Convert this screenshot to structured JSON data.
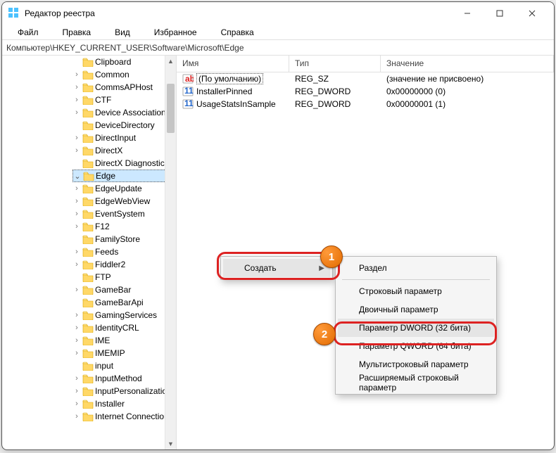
{
  "window": {
    "title": "Редактор реестра"
  },
  "menu": [
    "Файл",
    "Правка",
    "Вид",
    "Избранное",
    "Справка"
  ],
  "address": "Компьютер\\HKEY_CURRENT_USER\\Software\\Microsoft\\Edge",
  "list": {
    "headers": {
      "name": "Имя",
      "type": "Тип",
      "value": "Значение"
    },
    "rows": [
      {
        "icon": "string",
        "name": "(По умолчанию)",
        "type": "REG_SZ",
        "value": "(значение не присвоено)",
        "selected": true
      },
      {
        "icon": "dword",
        "name": "InstallerPinned",
        "type": "REG_DWORD",
        "value": "0x00000000 (0)"
      },
      {
        "icon": "dword",
        "name": "UsageStatsInSample",
        "type": "REG_DWORD",
        "value": "0x00000001 (1)"
      }
    ]
  },
  "tree": [
    {
      "name": "Clipboard",
      "caret": false
    },
    {
      "name": "Common",
      "caret": true
    },
    {
      "name": "CommsAPHost",
      "caret": true
    },
    {
      "name": "CTF",
      "caret": true
    },
    {
      "name": "Device Association",
      "caret": true,
      "truncated": true
    },
    {
      "name": "DeviceDirectory",
      "caret": false
    },
    {
      "name": "DirectInput",
      "caret": true
    },
    {
      "name": "DirectX",
      "caret": true
    },
    {
      "name": "DirectX Diagnostic",
      "caret": false,
      "truncated": true
    },
    {
      "name": "Edge",
      "caret": true,
      "open": true,
      "selected": true
    },
    {
      "name": "EdgeUpdate",
      "caret": true
    },
    {
      "name": "EdgeWebView",
      "caret": true
    },
    {
      "name": "EventSystem",
      "caret": true
    },
    {
      "name": "F12",
      "caret": true
    },
    {
      "name": "FamilyStore",
      "caret": false
    },
    {
      "name": "Feeds",
      "caret": true
    },
    {
      "name": "Fiddler2",
      "caret": true
    },
    {
      "name": "FTP",
      "caret": false
    },
    {
      "name": "GameBar",
      "caret": true
    },
    {
      "name": "GameBarApi",
      "caret": false
    },
    {
      "name": "GamingServices",
      "caret": true
    },
    {
      "name": "IdentityCRL",
      "caret": true
    },
    {
      "name": "IME",
      "caret": true
    },
    {
      "name": "IMEMIP",
      "caret": true
    },
    {
      "name": "input",
      "caret": false
    },
    {
      "name": "InputMethod",
      "caret": true
    },
    {
      "name": "InputPersonalization",
      "caret": true,
      "truncated": true
    },
    {
      "name": "Installer",
      "caret": true
    },
    {
      "name": "Internet Connection",
      "caret": true,
      "truncated": true
    }
  ],
  "contextMenu1": {
    "create": "Создать"
  },
  "contextMenu2": {
    "key": "Раздел",
    "string": "Строковый параметр",
    "binary": "Двоичный параметр",
    "dword": "Параметр DWORD (32 бита)",
    "qword": "Параметр QWORD (64 бита)",
    "multi": "Мультистроковый параметр",
    "expand": "Расширяемый строковый параметр"
  },
  "badges": {
    "one": "1",
    "two": "2"
  }
}
